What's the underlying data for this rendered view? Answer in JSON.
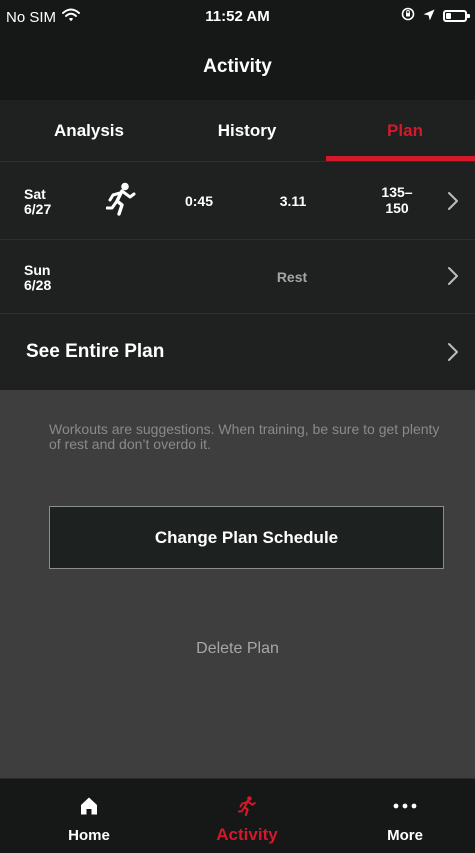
{
  "status": {
    "carrier": "No SIM",
    "time": "11:52 AM"
  },
  "header": {
    "title": "Activity"
  },
  "tabs": [
    {
      "label": "Analysis",
      "active": false
    },
    {
      "label": "History",
      "active": false
    },
    {
      "label": "Plan",
      "active": true
    }
  ],
  "plan_days": [
    {
      "day": "Sat",
      "date": "6/27",
      "icon": "running-icon",
      "duration": "0:45",
      "distance": "3.11",
      "heart_rate_low": "135–",
      "heart_rate_high": "150"
    },
    {
      "day": "Sun",
      "date": "6/28",
      "status": "Rest"
    }
  ],
  "see_plan": {
    "label": "See Entire Plan"
  },
  "info": {
    "note": "Workouts are suggestions. When training, be sure to get plenty of rest and don’t overdo it.",
    "change_schedule_label": "Change Plan Schedule",
    "delete_label": "Delete Plan"
  },
  "bottom_tabs": [
    {
      "label": "Home",
      "icon": "home-icon",
      "active": false
    },
    {
      "label": "Activity",
      "icon": "running-icon",
      "active": true
    },
    {
      "label": "More",
      "icon": "more-icon",
      "active": false
    }
  ],
  "colors": {
    "accent": "#d3192a",
    "background": "#151817",
    "row": "#1e2120",
    "panel": "#3e3e3e"
  }
}
